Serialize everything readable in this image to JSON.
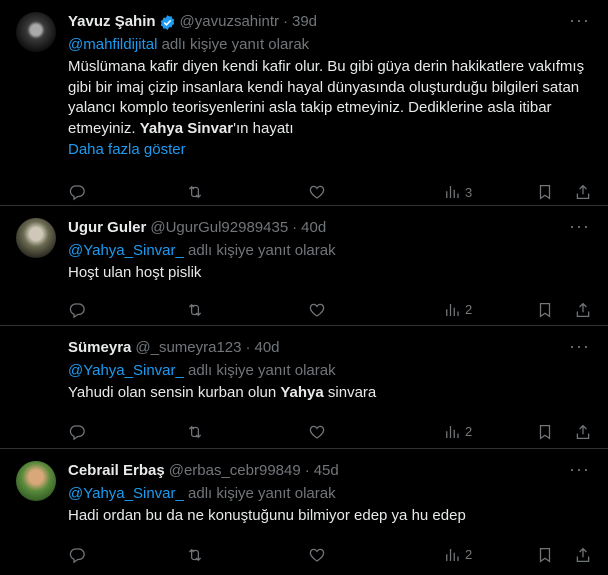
{
  "reply_prefix_suffix": "adlı kişiye yanıt olarak",
  "tweets": [
    {
      "name": "Yavuz Şahin",
      "handle": "@yavuzsahintr",
      "time": "39d",
      "verified": true,
      "reply_to": "@mahfildijital",
      "text_parts": [
        "Müslümana kafir diyen kendi kafir olur. Bu gibi güya derin hakikatlere vakıfmış gibi bir imaj çizip insanlara kendi hayal dünyasında oluşturduğu bilgileri satan yalancı komplo teorisyenlerini asla takip etmeyiniz. Dediklerine asla itibar etmeyiniz. ",
        "Yahya Sinvar",
        "'ın hayatı"
      ],
      "show_more": "Daha fazla göster",
      "views": "3"
    },
    {
      "name": "Ugur Guler",
      "handle": "@UgurGul92989435",
      "time": "40d",
      "reply_to": "@Yahya_Sinvar_",
      "text": "Hoşt ulan hoşt pislik",
      "views": "2"
    },
    {
      "name": "Sümeyra",
      "handle": "@_sumeyra123",
      "time": "40d",
      "reply_to": "@Yahya_Sinvar_",
      "text_parts": [
        "Yahudi olan sensin kurban olun ",
        "Yahya",
        " sinvara"
      ],
      "views": "2"
    },
    {
      "name": "Cebrail Erbaş",
      "handle": "@erbas_cebr99849",
      "time": "45d",
      "reply_to": "@Yahya_Sinvar_",
      "text": "Hadi ordan bu da ne konuştuğunu bilmiyor edep ya hu edep",
      "views": "2"
    }
  ],
  "separator": "·",
  "more_glyph": "···",
  "colors": {
    "background": "#000000",
    "text": "#e7e9ea",
    "muted": "#71767b",
    "accent": "#1d9bf0",
    "border": "#2f3336"
  }
}
